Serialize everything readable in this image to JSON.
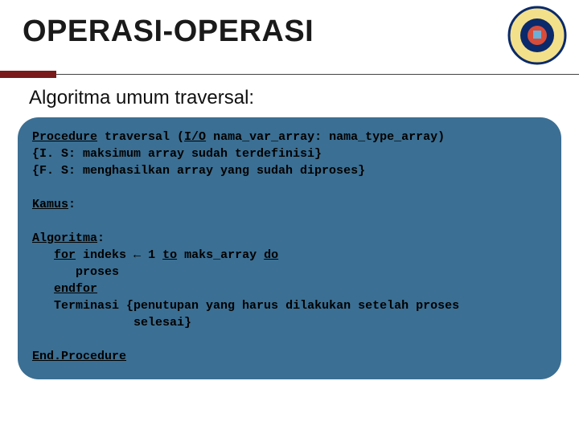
{
  "title": "OPERASI-OPERASI",
  "subtitle": "Algoritma umum traversal:",
  "logo": {
    "name": "university-logo"
  },
  "code": {
    "l1a": "Procedure",
    "l1b": " traversal (",
    "l1c": "I/O",
    "l1d": " nama_var_array: nama_type_array)",
    "l2": "{I. S: maksimum array sudah terdefinisi}",
    "l3": "{F. S: menghasilkan array yang sudah diproses}",
    "kamus": "Kamus",
    "colon": ":",
    "algoritma": "Algoritma",
    "for": "for",
    "forline_a": " indeks ",
    "arrow": "←",
    "forline_b": " 1 ",
    "to": "to",
    "forline_c": " maks_array ",
    "do": "do",
    "proses": "proses",
    "endfor": "endfor",
    "term": "Terminasi {penutupan yang harus dilakukan setelah proses",
    "term2": "selesai}",
    "endproc": "End.Procedure"
  }
}
